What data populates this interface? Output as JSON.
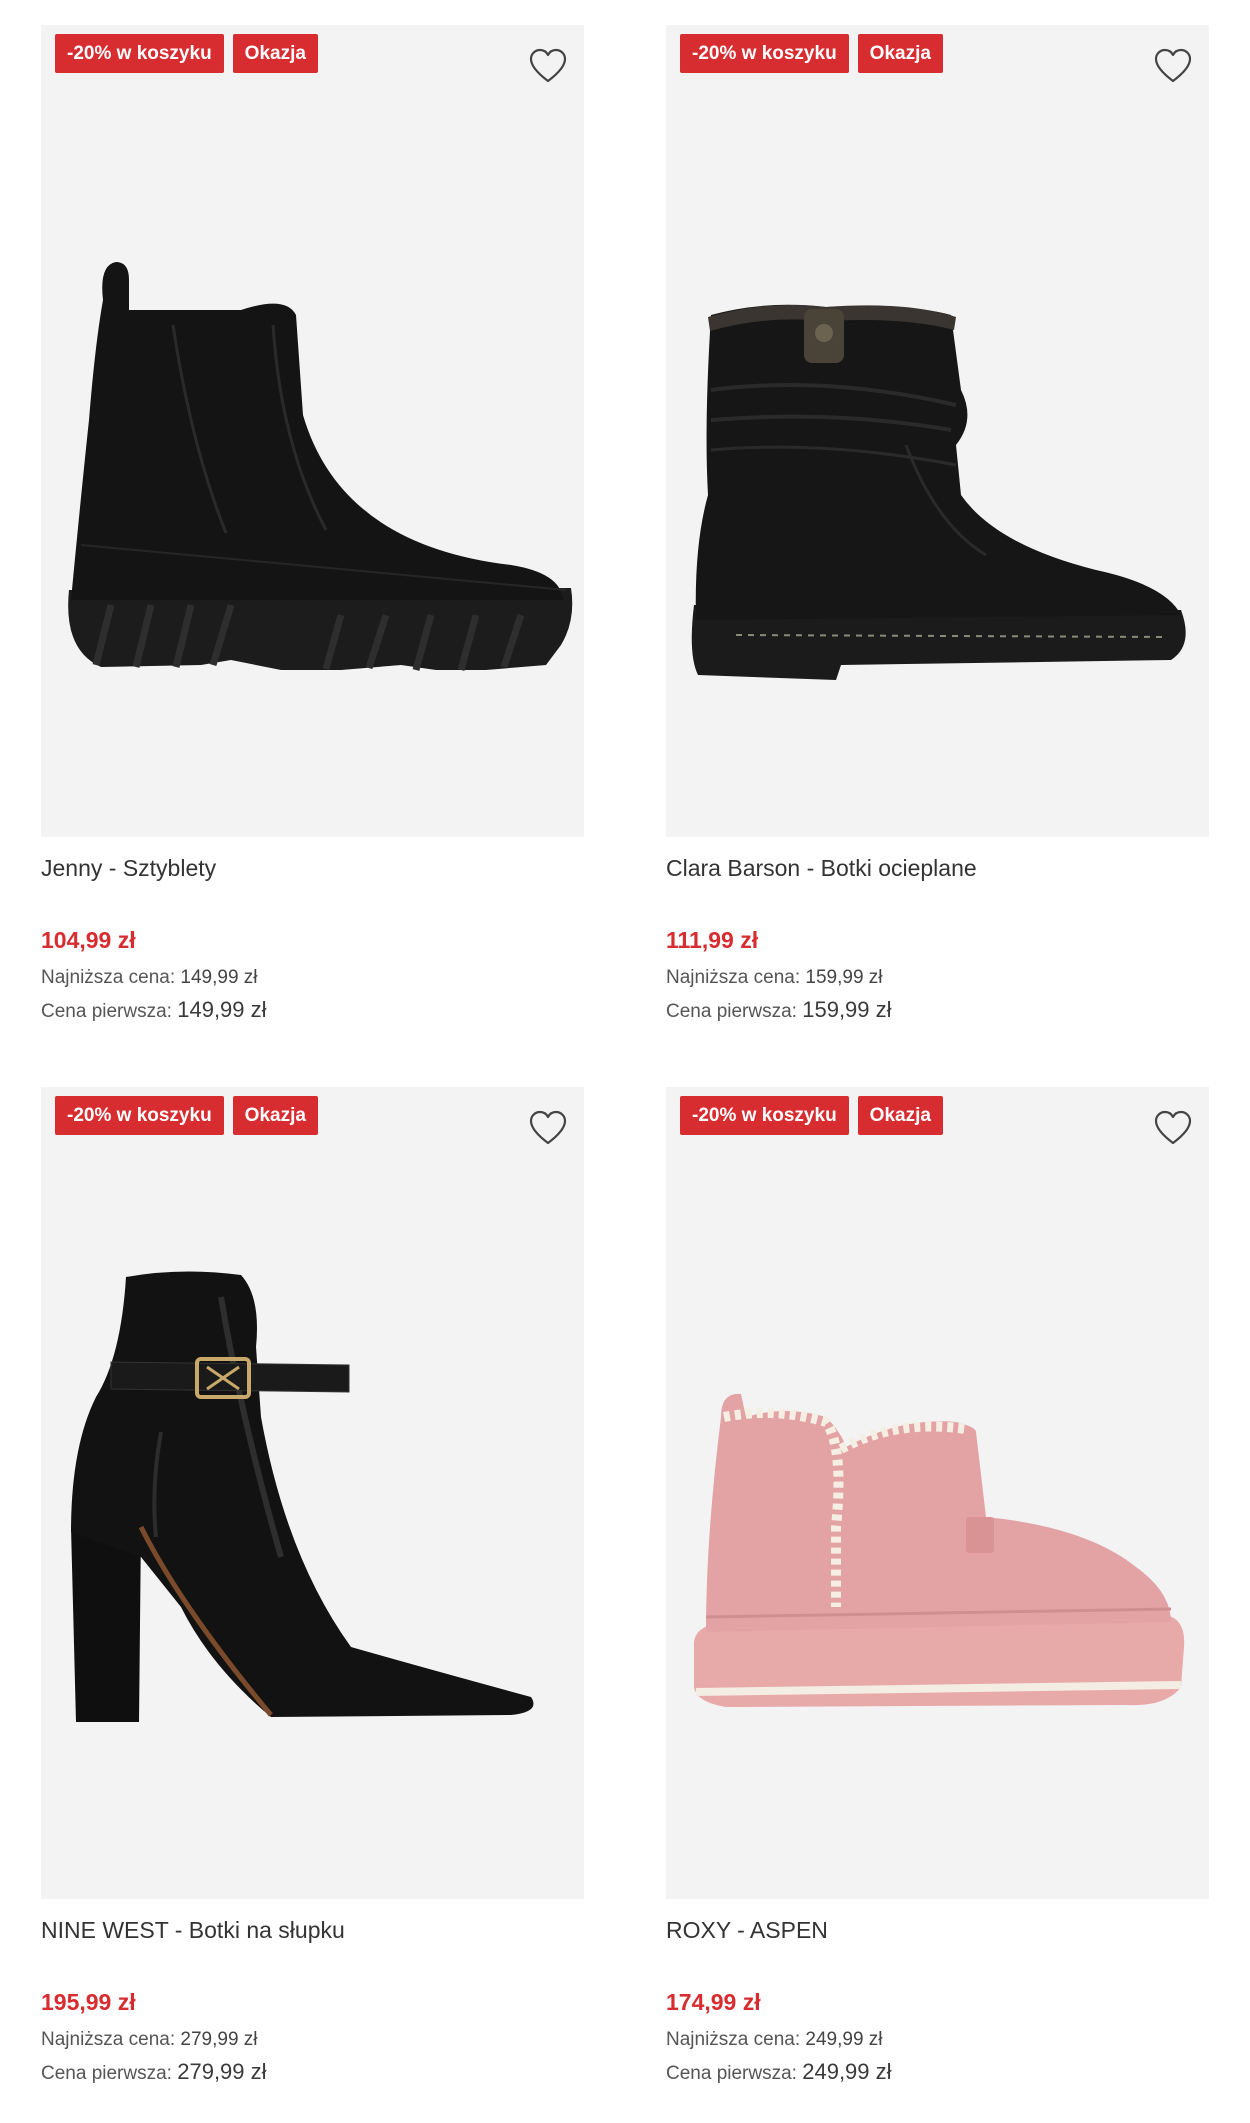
{
  "products": [
    {
      "name": "Jenny - Sztyblety",
      "badges": [
        "-20% w koszyku",
        "Okazja"
      ],
      "price": "104,99 zł",
      "lowest_price_label": "Najniższa cena:",
      "lowest_price": "149,99 zł",
      "first_price_label": "Cena pierwsza:",
      "first_price": "149,99 zł",
      "image_icon": "chelsea-boot-black"
    },
    {
      "name": "Clara Barson - Botki ocieplane",
      "badges": [
        "-20% w koszyku",
        "Okazja"
      ],
      "price": "111,99 zł",
      "lowest_price_label": "Najniższa cena:",
      "lowest_price": "159,99 zł",
      "first_price_label": "Cena pierwsza:",
      "first_price": "159,99 zł",
      "image_icon": "insulated-ankle-boot-black"
    },
    {
      "name": "NINE WEST - Botki na słupku",
      "badges": [
        "-20% w koszyku",
        "Okazja"
      ],
      "price": "195,99 zł",
      "lowest_price_label": "Najniższa cena:",
      "lowest_price": "279,99 zł",
      "first_price_label": "Cena pierwsza:",
      "first_price": "279,99 zł",
      "image_icon": "block-heel-ankle-boot-black"
    },
    {
      "name": "ROXY - ASPEN",
      "badges": [
        "-20% w koszyku",
        "Okazja"
      ],
      "price": "174,99 zł",
      "lowest_price_label": "Najniższa cena:",
      "lowest_price": "249,99 zł",
      "first_price_label": "Cena pierwsza:",
      "first_price": "249,99 zł",
      "image_icon": "platform-suede-boot-pink"
    }
  ],
  "icons": {
    "wishlist": "heart-outline-icon"
  },
  "colors": {
    "badge_background": "#d72c30",
    "price": "#d72c30",
    "image_background": "#f3f3f3"
  }
}
